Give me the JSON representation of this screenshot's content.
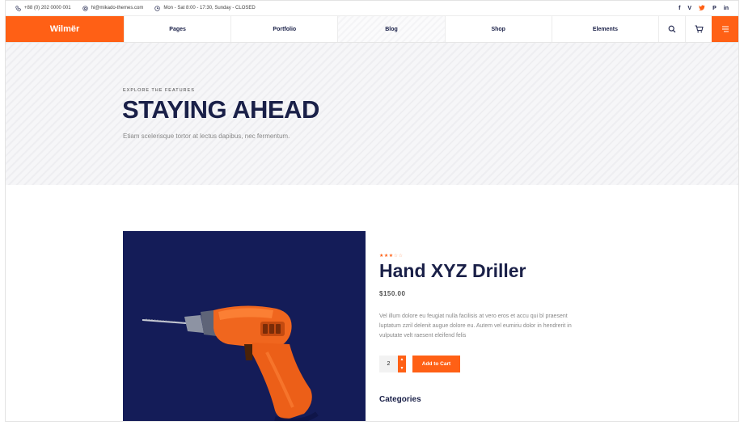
{
  "topbar": {
    "phone": "+88 (0) 202 0000 001",
    "email": "hi@mikado-themes.com",
    "hours": "Mon - Sat 8:00 - 17:30, Sunday - CLOSED",
    "social": [
      "f",
      "V",
      "t",
      "P",
      "in"
    ]
  },
  "nav": {
    "logo": "Wilmër",
    "items": [
      "Pages",
      "Portfolio",
      "Blog",
      "Shop",
      "Elements"
    ]
  },
  "hero": {
    "eyebrow": "EXPLORE THE FEATURES",
    "title": "STAYING AHEAD",
    "subtitle": "Etiam scelerisque tortor at lectus dapibus, nec fermentum."
  },
  "product": {
    "rating": 3,
    "rating_max": 5,
    "title": "Hand XYZ Driller",
    "price": "$150.00",
    "description": "Vel illum dolore eu feugiat nulla facilisis at vero eros et accu qui bl praesent luptatum zzril delenit augue dolore eu. Autem vel eumiriu dolor in hendrerit in vulputate velt raesent eleifend felis",
    "quantity": "2",
    "add_to_cart": "Add to Cart",
    "categories_heading": "Categories"
  },
  "colors": {
    "accent": "#ff6015",
    "navy": "#1a2048",
    "image_bg": "#141c58"
  }
}
